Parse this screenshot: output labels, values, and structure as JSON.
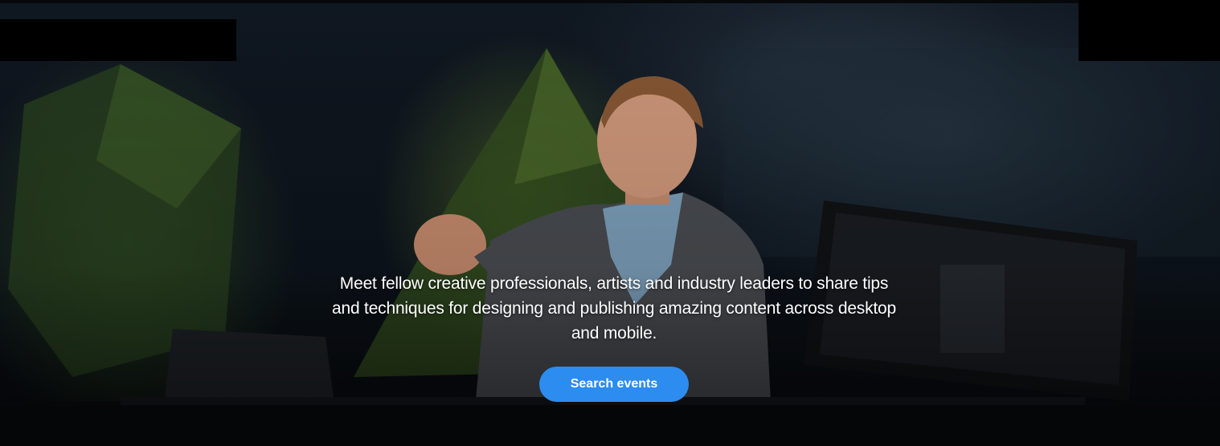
{
  "hero": {
    "description": "Meet fellow creative professionals, artists and industry leaders to share tips and techniques for designing and publishing amazing content across desktop and mobile.",
    "cta_label": "Search events",
    "cta_color": "#2c8cf0"
  }
}
